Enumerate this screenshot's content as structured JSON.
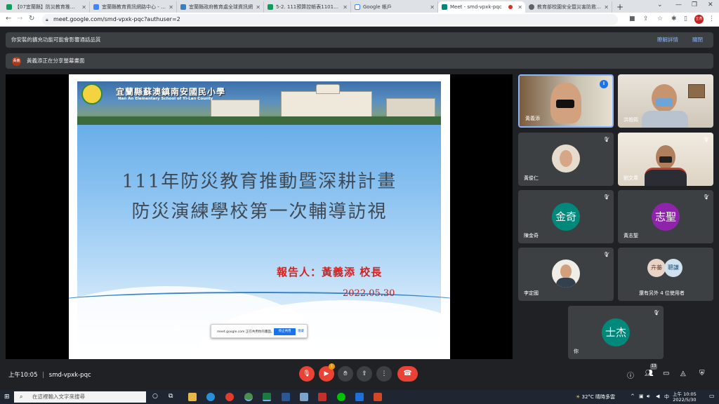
{
  "browser": {
    "tabs": [
      {
        "label": "【07宜蘭縣】防災教育推動計畫分組...",
        "color": "#0f9d58"
      },
      {
        "label": "宜蘭縣教育資訊網路中心 - 數位學...",
        "color": "#4285f4"
      },
      {
        "label": "宜蘭縣政府教育處全球資訊網",
        "color": "#3a7ebf"
      },
      {
        "label": "5-2. 111預算控帳表1101122(4)",
        "color": "#0f9d58"
      },
      {
        "label": "Google 帳戶",
        "color": "#ffffff"
      },
      {
        "label": "Meet - smd-vpxk-pqc",
        "color": "#00897b"
      },
      {
        "label": "教育部校園安全暨災害防救通報...",
        "color": "#5f6368"
      }
    ],
    "active_tab": 5,
    "new_tab": "+",
    "url": "meet.google.com/smd-vpxk-pqc?authuser=2",
    "profile_initial": "士杰"
  },
  "banners": {
    "warning_text": "你安裝的擴充功能可能會影響通話品質",
    "details_link": "瞭解詳情",
    "close_link": "關閉",
    "presenting_avatar": "黃義",
    "presenting_text": "黃義添正在分享螢幕畫面"
  },
  "slide": {
    "school_name": "宜蘭縣蘇澳鎮南安國民小學",
    "school_name_en": "Nan An Elementary School of Yi-Lan County",
    "title_line1": "111年防災教育推動暨深耕計畫",
    "title_line2": "防災演練學校第一次輔導訪視",
    "reporter": "報告人：黃義添 校長",
    "date": "2022.05.30"
  },
  "share_popup": {
    "message": "meet.google.com 正在共用你的畫面。",
    "stop_button": "停止共用",
    "hide_button": "隱藏"
  },
  "participants": [
    {
      "name": "黃義添",
      "type": "video",
      "speaking": true
    },
    {
      "name": "洪祖熙",
      "type": "video"
    },
    {
      "name": "黃俊仁",
      "type": "photo"
    },
    {
      "name": "劉文章",
      "type": "video"
    },
    {
      "name": "陳金奇",
      "type": "initials",
      "initials": "金奇",
      "color": "#00897b"
    },
    {
      "name": "黃志聖",
      "type": "initials",
      "initials": "志聖",
      "color": "#8e24aa"
    },
    {
      "name": "李定國",
      "type": "photo"
    },
    {
      "name": "還有另外 4 位使用者",
      "type": "group",
      "avatars": [
        "卉蓁",
        "聰謙"
      ]
    },
    {
      "name": "你",
      "type": "initials",
      "initials": "士杰",
      "color": "#00897b"
    }
  ],
  "bottom_bar": {
    "time": "上午10:05",
    "separator": "|",
    "meeting_code": "smd-vpxk-pqc",
    "participant_count": "13",
    "reaction_badge": "!"
  },
  "taskbar": {
    "search_placeholder": "在這裡輸入文字來搜尋",
    "weather": "32°C  晴時多雲",
    "ime": "中",
    "clock_time": "上午 10:05",
    "clock_date": "2022/5/30"
  },
  "colors": {
    "meet_bg": "#202124",
    "tile_bg": "#3c4043",
    "hangup_red": "#ea4335",
    "accent_blue": "#8ab4f8"
  }
}
